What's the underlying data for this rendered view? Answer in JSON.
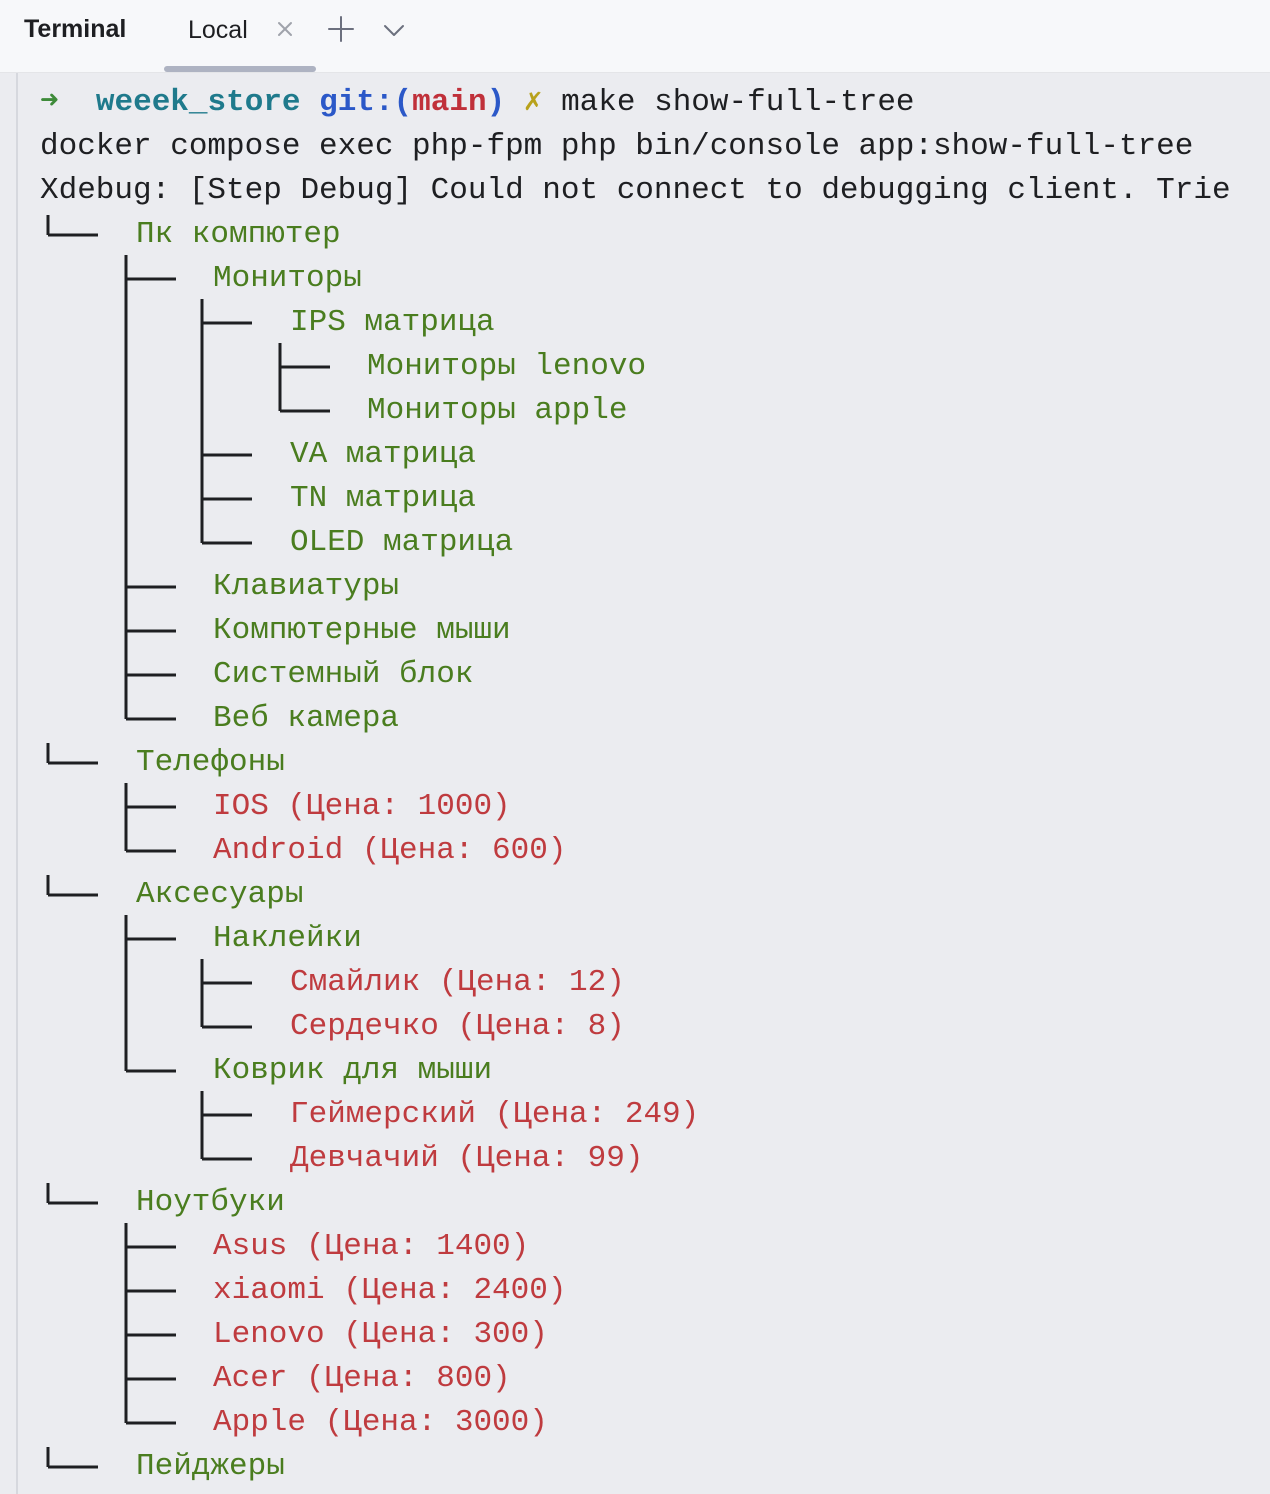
{
  "tabbar": {
    "title": "Terminal",
    "tab_label": "Local",
    "close_icon": "close-icon",
    "add_icon": "plus-icon",
    "dropdown_icon": "chevron-down-icon"
  },
  "prompt": {
    "arrow": "➜",
    "directory": "weeek_store",
    "git_prefix": "git:(",
    "branch": "main",
    "git_suffix": ")",
    "dirty_mark": "✗",
    "command": "make show-full-tree"
  },
  "output": {
    "docker_line": "docker compose exec php-fpm php bin/console app:show-full-tree",
    "xdebug_line": "Xdebug: [Step Debug] Could not connect to debugging client. Trie"
  },
  "colors": {
    "category": "#4a7d1f",
    "product": "#bf3b3f",
    "background": "#ebecf0"
  },
  "tree": [
    {
      "label": "Пк компютер",
      "kind": "category",
      "depth": 0
    },
    {
      "label": "Мониторы",
      "kind": "category",
      "depth": 1
    },
    {
      "label": "IPS матрица",
      "kind": "category",
      "depth": 2
    },
    {
      "label": "Мониторы lenovo",
      "kind": "category",
      "depth": 3
    },
    {
      "label": "Мониторы apple",
      "kind": "category",
      "depth": 3
    },
    {
      "label": "VA матрица",
      "kind": "category",
      "depth": 2
    },
    {
      "label": "TN матрица",
      "kind": "category",
      "depth": 2
    },
    {
      "label": "OLED матрица",
      "kind": "category",
      "depth": 2
    },
    {
      "label": "Клавиатуры",
      "kind": "category",
      "depth": 1
    },
    {
      "label": "Компютерные мыши",
      "kind": "category",
      "depth": 1
    },
    {
      "label": "Системный блок",
      "kind": "category",
      "depth": 1
    },
    {
      "label": "Веб камера",
      "kind": "category",
      "depth": 1
    },
    {
      "label": "Телефоны",
      "kind": "category",
      "depth": 0
    },
    {
      "label": "IOS (Цена: 1000)",
      "kind": "product",
      "depth": 1
    },
    {
      "label": "Android (Цена: 600)",
      "kind": "product",
      "depth": 1
    },
    {
      "label": "Аксесуары",
      "kind": "category",
      "depth": 0
    },
    {
      "label": "Наклейки",
      "kind": "category",
      "depth": 1
    },
    {
      "label": "Смайлик (Цена: 12)",
      "kind": "product",
      "depth": 2
    },
    {
      "label": "Сердечко (Цена: 8)",
      "kind": "product",
      "depth": 2
    },
    {
      "label": "Коврик для мыши",
      "kind": "category",
      "depth": 1
    },
    {
      "label": "Геймерский (Цена: 249)",
      "kind": "product",
      "depth": 2
    },
    {
      "label": "Девчачий (Цена: 99)",
      "kind": "product",
      "depth": 2
    },
    {
      "label": "Ноутбуки",
      "kind": "category",
      "depth": 0
    },
    {
      "label": "Asus (Цена: 1400)",
      "kind": "product",
      "depth": 1
    },
    {
      "label": "xiaomi (Цена: 2400)",
      "kind": "product",
      "depth": 1
    },
    {
      "label": "Lenovo (Цена: 300)",
      "kind": "product",
      "depth": 1
    },
    {
      "label": "Acer (Цена: 800)",
      "kind": "product",
      "depth": 1
    },
    {
      "label": "Apple (Цена: 3000)",
      "kind": "product",
      "depth": 1
    },
    {
      "label": "Пейджеры",
      "kind": "category",
      "depth": 0
    }
  ]
}
